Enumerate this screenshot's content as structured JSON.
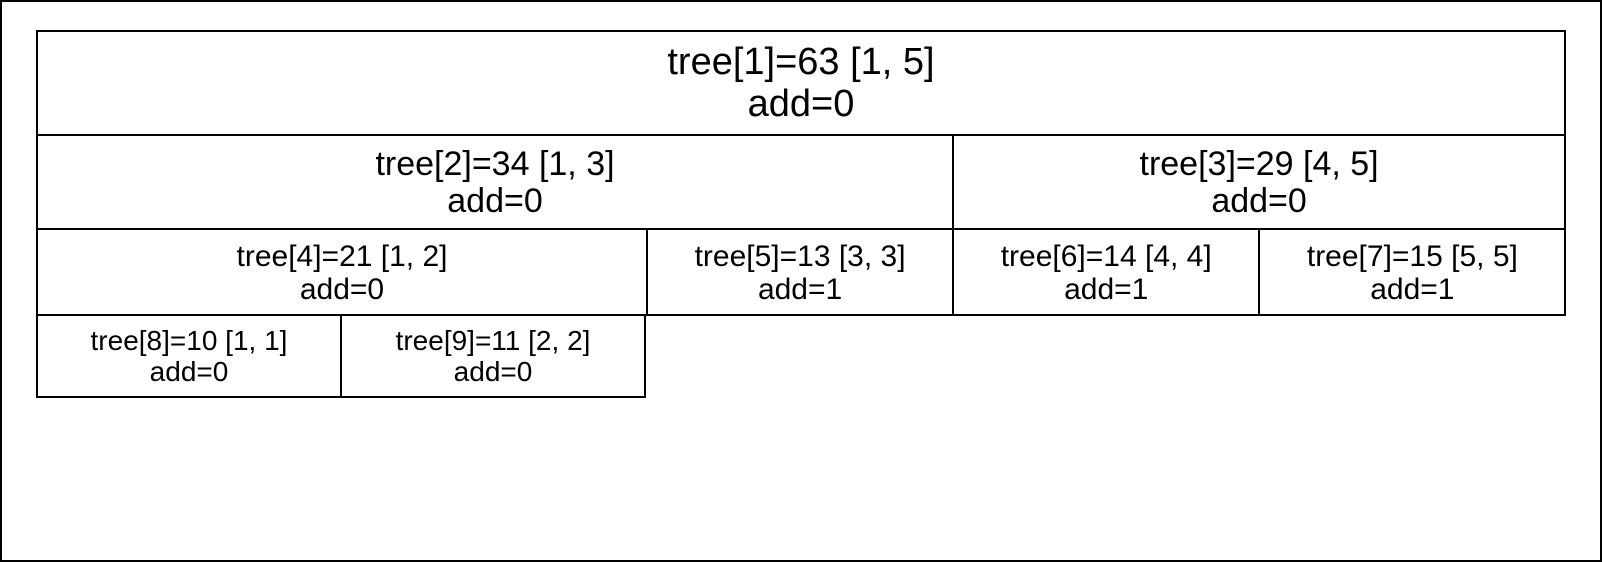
{
  "nodes": {
    "n1": {
      "title": "tree[1]=63 [1, 5]",
      "sub": "add=0"
    },
    "n2": {
      "title": "tree[2]=34 [1, 3]",
      "sub": "add=0"
    },
    "n3": {
      "title": "tree[3]=29 [4, 5]",
      "sub": "add=0"
    },
    "n4": {
      "title": "tree[4]=21 [1, 2]",
      "sub": "add=0"
    },
    "n5": {
      "title": "tree[5]=13 [3, 3]",
      "sub": "add=1"
    },
    "n6": {
      "title": "tree[6]=14 [4, 4]",
      "sub": "add=1"
    },
    "n7": {
      "title": "tree[7]=15 [5, 5]",
      "sub": "add=1"
    },
    "n8": {
      "title": "tree[8]=10 [1, 1]",
      "sub": "add=0"
    },
    "n9": {
      "title": "tree[9]=11 [2, 2]",
      "sub": "add=0"
    }
  },
  "chart_data": {
    "type": "table",
    "structure": "segment-tree",
    "range": [
      1,
      5
    ],
    "nodes": [
      {
        "id": 1,
        "range": [
          1,
          5
        ],
        "value": 63,
        "add": 0,
        "children": [
          2,
          3
        ]
      },
      {
        "id": 2,
        "range": [
          1,
          3
        ],
        "value": 34,
        "add": 0,
        "children": [
          4,
          5
        ]
      },
      {
        "id": 3,
        "range": [
          4,
          5
        ],
        "value": 29,
        "add": 0,
        "children": [
          6,
          7
        ]
      },
      {
        "id": 4,
        "range": [
          1,
          2
        ],
        "value": 21,
        "add": 0,
        "children": [
          8,
          9
        ]
      },
      {
        "id": 5,
        "range": [
          3,
          3
        ],
        "value": 13,
        "add": 1,
        "children": []
      },
      {
        "id": 6,
        "range": [
          4,
          4
        ],
        "value": 14,
        "add": 1,
        "children": []
      },
      {
        "id": 7,
        "range": [
          5,
          5
        ],
        "value": 15,
        "add": 1,
        "children": []
      },
      {
        "id": 8,
        "range": [
          1,
          1
        ],
        "value": 10,
        "add": 0,
        "children": []
      },
      {
        "id": 9,
        "range": [
          2,
          2
        ],
        "value": 11,
        "add": 0,
        "children": []
      }
    ]
  }
}
